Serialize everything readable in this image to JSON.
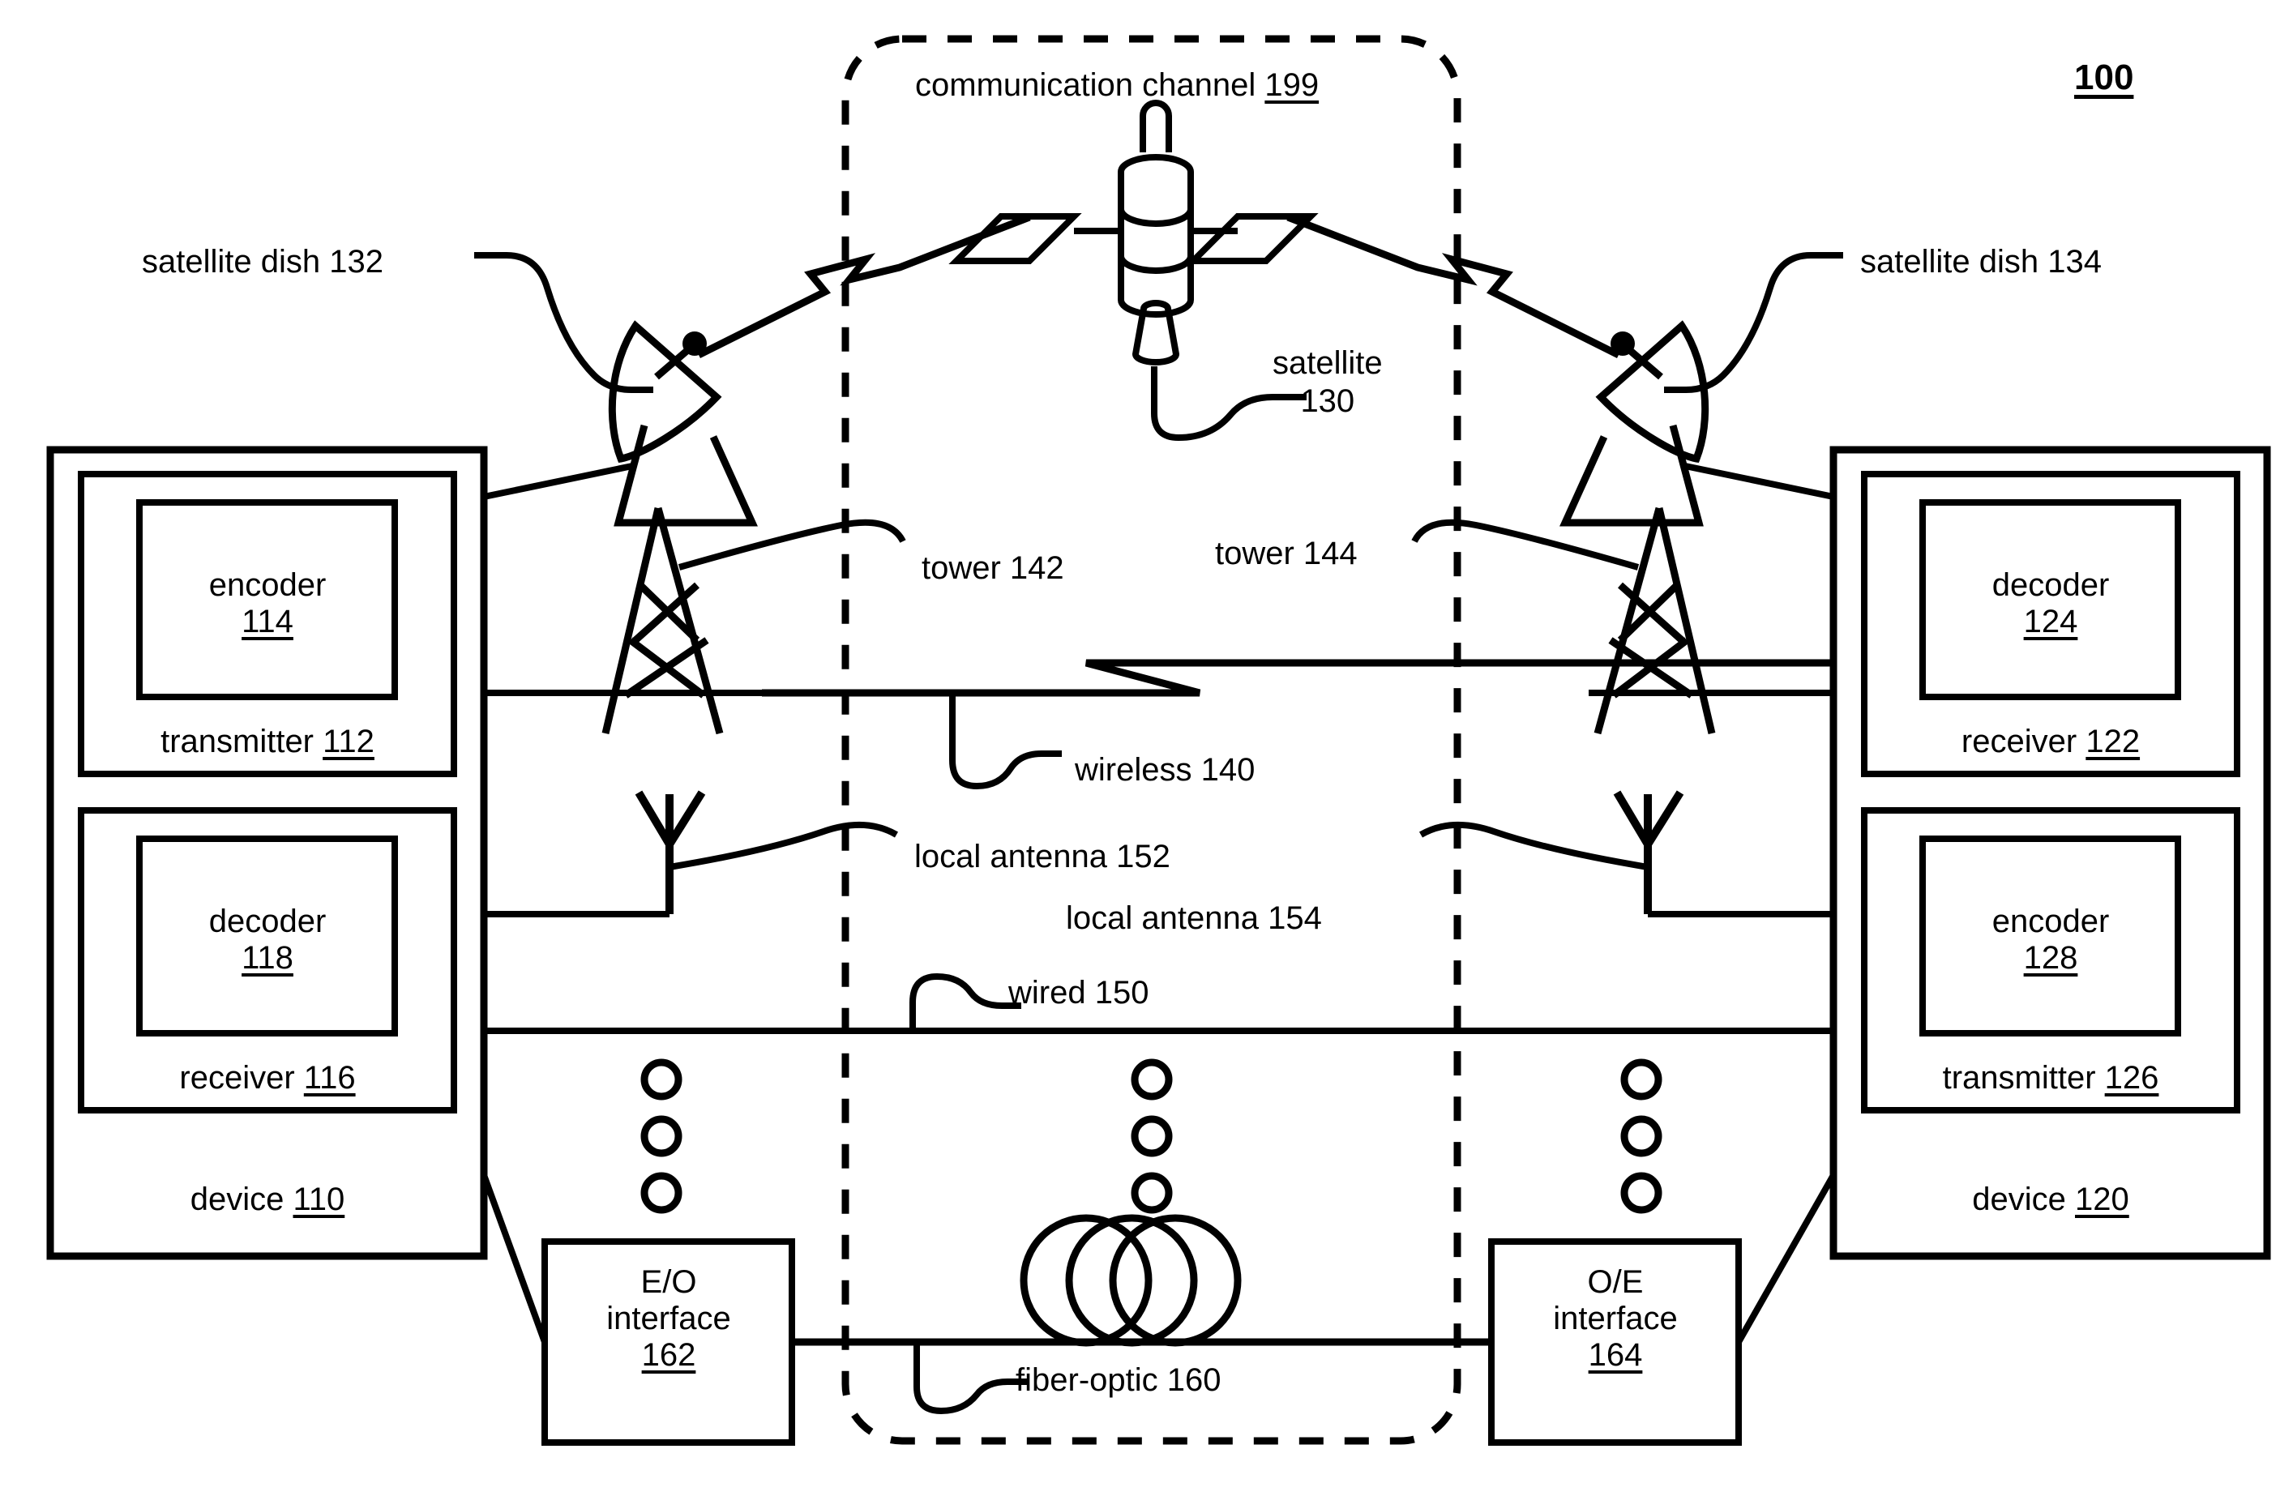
{
  "figure": {
    "number": "100"
  },
  "channel": {
    "label": "communication channel",
    "ref": "199"
  },
  "device_left": {
    "name": "device",
    "ref": "110",
    "transmitter": {
      "name": "transmitter",
      "ref": "112"
    },
    "encoder": {
      "name": "encoder",
      "ref": "114"
    },
    "receiver": {
      "name": "receiver",
      "ref": "116"
    },
    "decoder": {
      "name": "decoder",
      "ref": "118"
    }
  },
  "device_right": {
    "name": "device",
    "ref": "120",
    "receiver": {
      "name": "receiver",
      "ref": "122"
    },
    "decoder": {
      "name": "decoder",
      "ref": "124"
    },
    "transmitter": {
      "name": "transmitter",
      "ref": "126"
    },
    "encoder": {
      "name": "encoder",
      "ref": "128"
    }
  },
  "links": {
    "satellite": {
      "label": "satellite",
      "ref": "130",
      "text_line1": "satellite",
      "text_line2": "130"
    },
    "dish_left": {
      "label": "satellite dish 132"
    },
    "dish_right": {
      "label": "satellite dish 134"
    },
    "wireless": {
      "label": "wireless 140"
    },
    "tower_left": {
      "label": "tower 142"
    },
    "tower_right": {
      "label": "tower 144"
    },
    "wired": {
      "label": "wired 150"
    },
    "antenna_left": {
      "label": "local antenna 152"
    },
    "antenna_right": {
      "label": "local antenna 154"
    },
    "fiber": {
      "label": "fiber-optic 160"
    },
    "eo_interface": {
      "line1": "E/O",
      "line2": "interface",
      "ref": "162"
    },
    "oe_interface": {
      "line1": "O/E",
      "line2": "interface",
      "ref": "164"
    }
  },
  "colors": {
    "stroke": "#000000",
    "background": "#ffffff"
  }
}
